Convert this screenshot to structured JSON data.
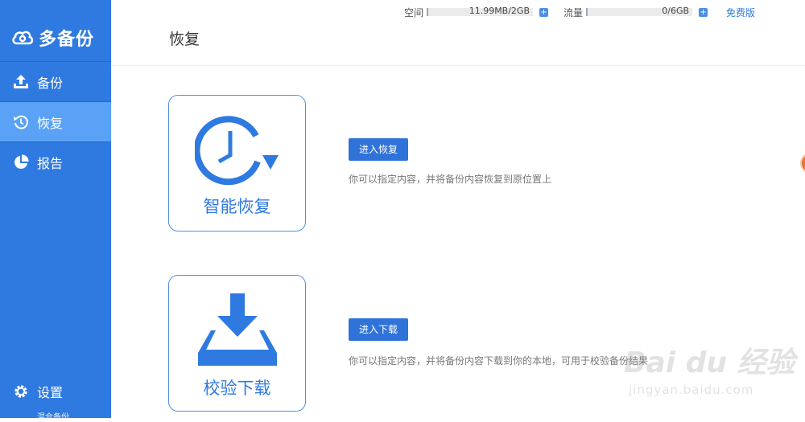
{
  "app": {
    "logo_text": "多备份",
    "edition": "混合备份"
  },
  "sidebar": {
    "items": [
      {
        "label": "备份",
        "icon": "upload-icon"
      },
      {
        "label": "恢复",
        "icon": "history-icon",
        "active": true
      },
      {
        "label": "报告",
        "icon": "pie-chart-icon"
      }
    ],
    "settings_label": "设置"
  },
  "header": {
    "title": "恢复",
    "space": {
      "label": "空间",
      "value": "11.99MB/2GB",
      "used_fraction": 0.006
    },
    "traffic": {
      "label": "流量",
      "value": "0/6GB",
      "used_fraction": 0.0
    },
    "plan_link": "免费版"
  },
  "cards": [
    {
      "label": "智能恢复",
      "icon": "clock-restore-icon",
      "button": "进入恢复",
      "description": "你可以指定内容，并将备份内容恢复到原位置上"
    },
    {
      "label": "校验下载",
      "icon": "download-tray-icon",
      "button": "进入下载",
      "description": "你可以指定内容，并将备份内容下载到你的本地，可用于校验备份结果"
    }
  ],
  "watermark": {
    "main": "Bai du 经验",
    "sub": "jingyan.baidu.com"
  },
  "colors": {
    "sidebar": "#2f7ae0",
    "active_item": "#5aa2f5",
    "accent": "#2f73d9",
    "card_border": "#4f8ee0"
  }
}
